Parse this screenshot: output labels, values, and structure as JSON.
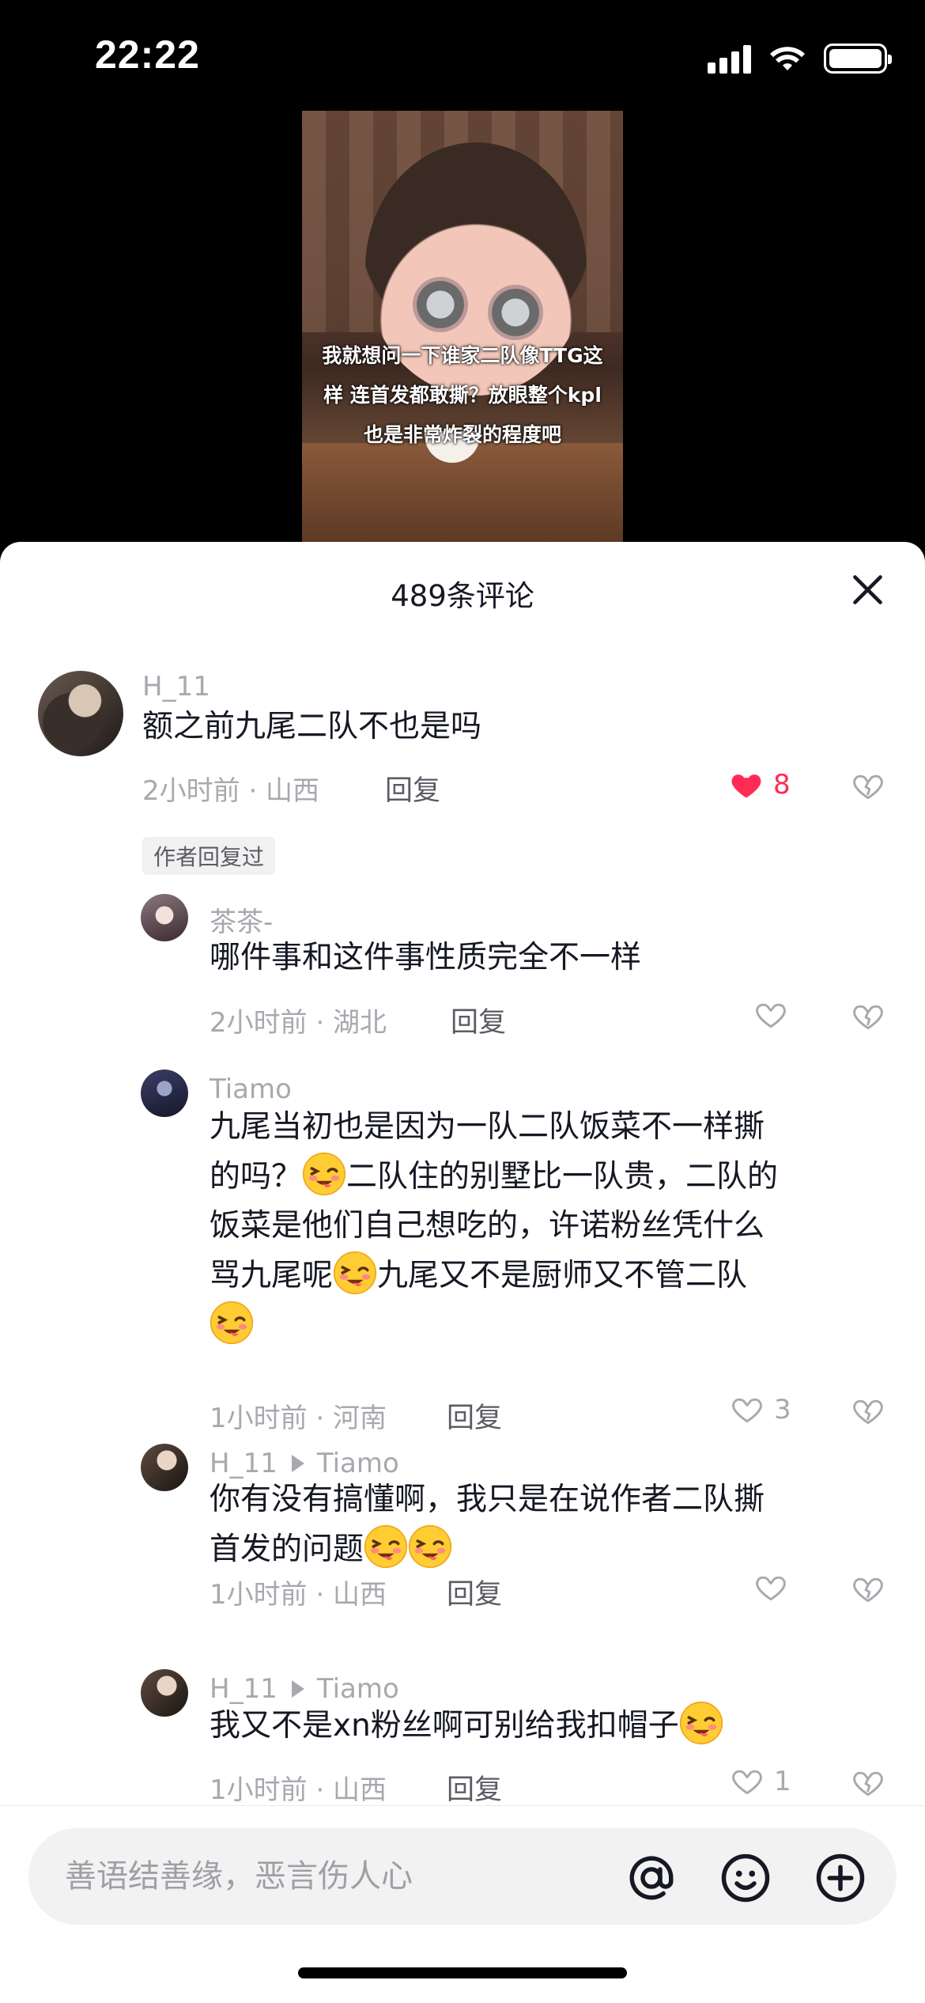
{
  "status_bar": {
    "time": "22:22"
  },
  "video": {
    "caption_lines": [
      "我就想问一下谁家二队像TTG这",
      "样 连首发都敢撕？放眼整个kpl",
      "也是非常炸裂的程度吧"
    ]
  },
  "comments_panel": {
    "title": "489条评论",
    "comments": [
      {
        "author": "H_11",
        "text": "额之前九尾二队不也是吗",
        "meta": "2小时前 · 山西",
        "reply_label": "回复",
        "likes": "8",
        "liked": true,
        "badge": "作者回复过"
      },
      {
        "author": "茶茶-",
        "text": "哪件事和这件事性质完全不一样",
        "meta": "2小时前 · 湖北",
        "reply_label": "回复",
        "likes": ""
      },
      {
        "author": "Tiamo",
        "text_parts": [
          "九尾当初也是因为一队二队饭菜不一样撕",
          "的吗？",
          "二队住的别墅比一队贵，二队的",
          "饭菜是他们自己想吃的，许诺粉丝凭什么",
          "骂九尾呢",
          "九尾又不是厨师又不管二队"
        ],
        "meta": "1小时前 · 河南",
        "reply_label": "回复",
        "likes": "3"
      },
      {
        "author": "H_11",
        "reply_to": "Tiamo",
        "text_parts": [
          "你有没有搞懂啊，我只是在说作者二队撕",
          "首发的问题"
        ],
        "meta": "1小时前 · 山西",
        "reply_label": "回复",
        "likes": ""
      },
      {
        "author": "H_11",
        "reply_to": "Tiamo",
        "text": "我又不是xn粉丝啊可别给我扣帽子",
        "meta": "1小时前 · 山西",
        "reply_label": "回复",
        "likes": "1"
      }
    ]
  },
  "input": {
    "placeholder": "善语结善缘，恶言伤人心"
  },
  "icons": {
    "close": "close-icon",
    "heart": "heart-icon",
    "dislike": "broken-heart-icon",
    "mention": "at-icon",
    "emoji": "smiley-icon",
    "add": "plus-circle-icon"
  },
  "colors": {
    "like_active": "#fe2c55",
    "muted": "#a8a9ae",
    "text": "#161823"
  }
}
